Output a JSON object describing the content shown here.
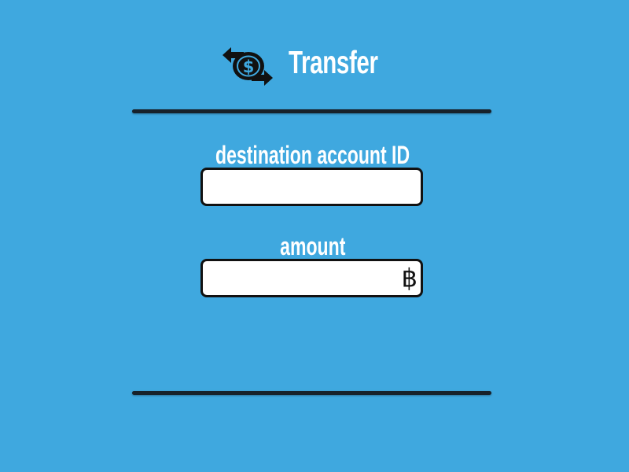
{
  "header": {
    "icon": "money-transfer-icon",
    "title": "Transfer"
  },
  "form": {
    "destination": {
      "label": "destination account ID",
      "value": "",
      "placeholder": ""
    },
    "amount": {
      "label": "amount",
      "value": "",
      "placeholder": "",
      "currency_symbol": "฿"
    }
  },
  "colors": {
    "background": "#3fa8df",
    "divider": "#17222b",
    "text": "#ffffff",
    "input_border": "#111111"
  }
}
